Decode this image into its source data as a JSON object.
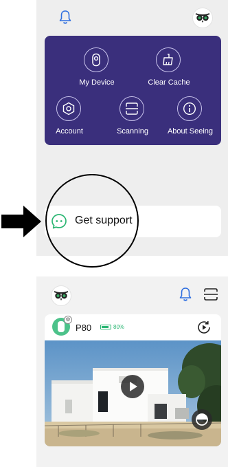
{
  "menu_screen": {
    "icons": {
      "bell": "bell-icon",
      "avatar": "owl-logo-icon"
    },
    "menu": [
      {
        "label": "My Device",
        "icon": "device-icon"
      },
      {
        "label": "Clear Cache",
        "icon": "broom-icon"
      },
      {
        "label": "Account",
        "icon": "hexagon-icon"
      },
      {
        "label": "Scanning",
        "icon": "scan-icon"
      },
      {
        "label": "About Seeing",
        "icon": "info-icon"
      }
    ],
    "support": {
      "label": "Get support",
      "icon": "chat-bubble-icon"
    }
  },
  "home_screen": {
    "icons": {
      "bell": "bell-icon",
      "scan": "scan-icon",
      "avatar": "owl-logo-icon"
    },
    "device": {
      "name": "P80",
      "battery_text": "80%",
      "battery_level": 0.8,
      "icons": {
        "playback": "playback-icon",
        "play": "play-icon",
        "ptz": "ptz-icon"
      }
    }
  },
  "colors": {
    "menu_card": "#3a2f7c",
    "accent_blue": "#2f6fe0",
    "support_green": "#2bb673",
    "battery_green": "#2bb673"
  }
}
